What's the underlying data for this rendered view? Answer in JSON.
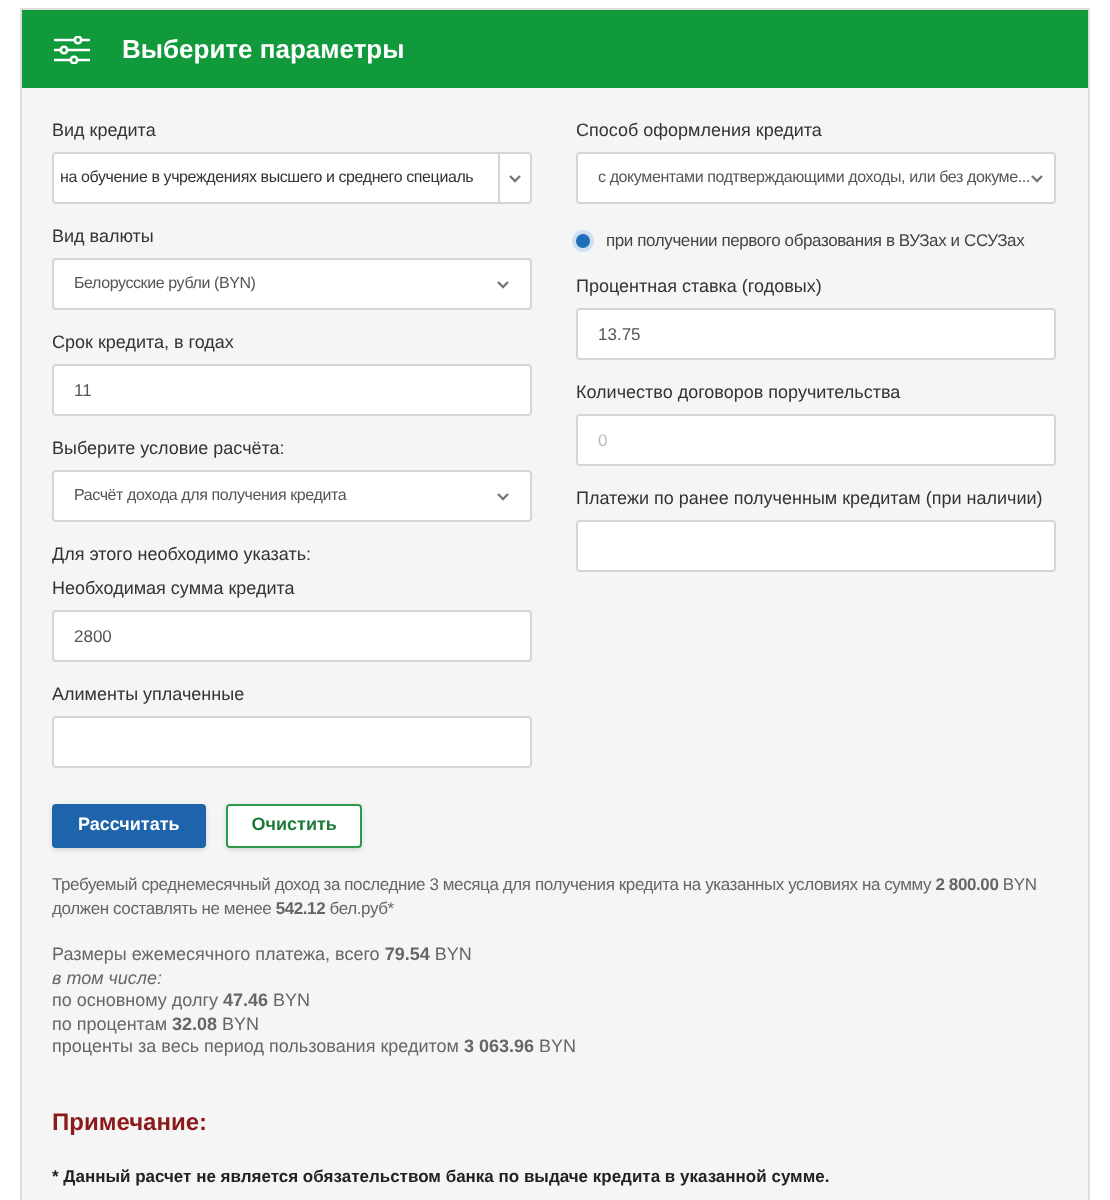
{
  "header": {
    "title": "Выберите параметры"
  },
  "left_fields": [
    {
      "kind": "combo",
      "label": "Вид кредита",
      "value": "на обучение в учреждениях высшего и среднего специаль"
    },
    {
      "kind": "select",
      "label": "Вид валюты",
      "value": "Белорусские рубли (BYN)"
    },
    {
      "kind": "input",
      "label": "Срок кредита, в годах",
      "value": "11"
    },
    {
      "kind": "select",
      "label": "Выберите условие расчёта:",
      "value": "Расчёт дохода для получения кредита"
    },
    {
      "kind": "input",
      "note": "Для этого необходимо указать:",
      "label": "Необходимая сумма кредита",
      "value": "2800"
    },
    {
      "kind": "input",
      "label": "Алименты уплаченные"
    }
  ],
  "right_fields": [
    {
      "kind": "select",
      "label": "Способ оформления кредита",
      "value": "с документами подтверждающими доходы, или без докуме..."
    },
    {
      "kind": "radio",
      "label": "при получении первого образования в ВУЗах и ССУЗах",
      "selected": true
    },
    {
      "kind": "input",
      "label": "Процентная ставка (годовых)",
      "value": "13.75"
    },
    {
      "kind": "input",
      "label": "Количество договоров поручительства",
      "placeholder": "0"
    },
    {
      "kind": "input",
      "label": "Платежи по ранее полученным  кредитам (при наличии)"
    }
  ],
  "buttons": [
    {
      "kind": "primary",
      "label": "Рассчитать"
    },
    {
      "kind": "secondary",
      "label": "Очистить"
    }
  ],
  "result": {
    "summary": "Требуемый среднемесячный доход за последние 3 месяца для получения кредита на указанных условиях на сумму **2 800.00** BYN должен составлять не менее **542.12** бел.руб*",
    "lines": [
      {
        "kind": "plain",
        "text": "Размеры ежемесячного платежа, всего **79.54** BYN"
      },
      {
        "kind": "emphasis",
        "text": "в том числе:"
      },
      {
        "kind": "plain",
        "text": "по основному долгу **47.46** BYN"
      },
      {
        "kind": "plain",
        "text": "по процентам **32.08** BYN"
      },
      {
        "kind": "plain",
        "text": "проценты за весь период пользования кредитом **3 063.96** BYN"
      }
    ]
  },
  "note": {
    "title": "Примечание:",
    "text": "* Данный расчет не является обязательством банка по выдаче кредита в указанной сумме."
  }
}
